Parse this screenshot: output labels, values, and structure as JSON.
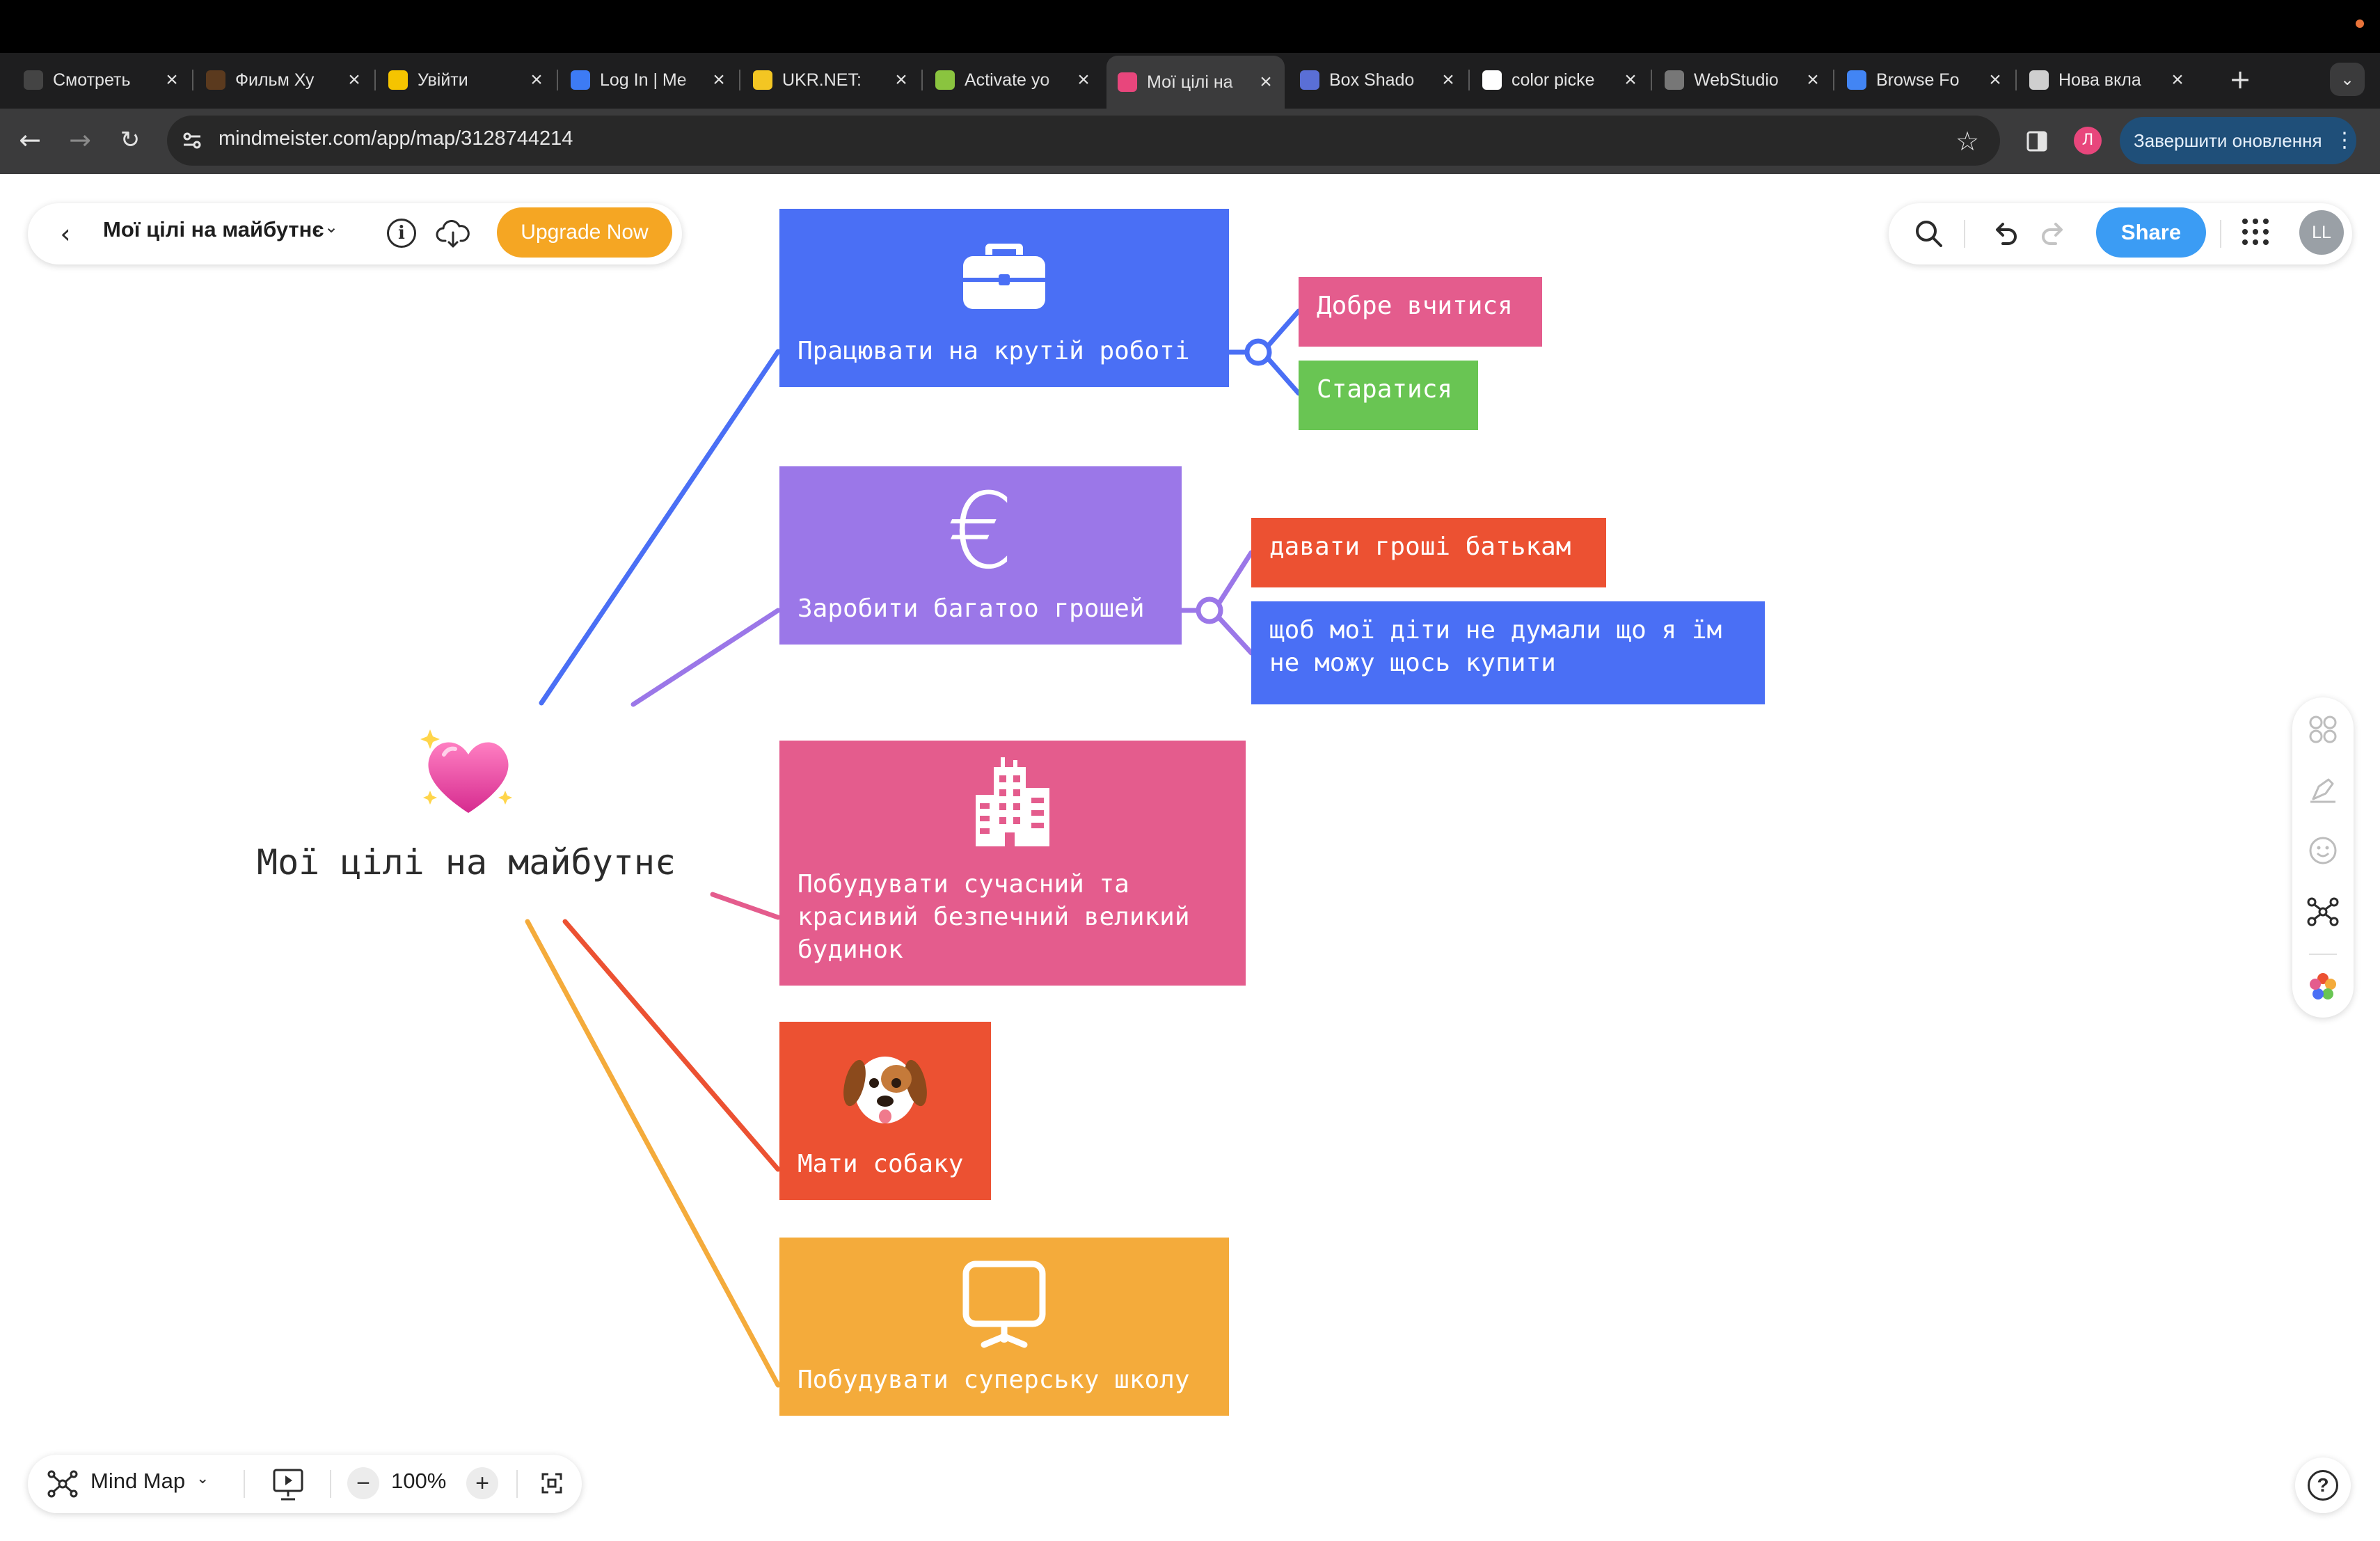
{
  "browser": {
    "tabs": [
      {
        "title": "Смотреть",
        "favicon": "hd-icon",
        "color": "#444444"
      },
      {
        "title": "Фильм Ху",
        "favicon": "mask-icon",
        "color": "#5b3a1e"
      },
      {
        "title": "Увійти",
        "favicon": "login-icon",
        "color": "#f5c400"
      },
      {
        "title": "Log In | Me",
        "favicon": "star-icon",
        "color": "#3d7bf4"
      },
      {
        "title": "UKR.NET:",
        "favicon": "ukrnet-icon",
        "color": "#f3c623"
      },
      {
        "title": "Activate yo",
        "favicon": "android-icon",
        "color": "#8ac43f"
      },
      {
        "title": "Мої цілі на",
        "favicon": "mindmeister-icon",
        "color": "#e8467c",
        "active": true
      },
      {
        "title": "Box Shado",
        "favicon": "box-icon",
        "color": "#5a6fd6"
      },
      {
        "title": "color picke",
        "favicon": "google-icon",
        "color": "#ffffff"
      },
      {
        "title": "WebStudio",
        "favicon": "globe-icon",
        "color": "#777777"
      },
      {
        "title": "Browse Fo",
        "favicon": "fonts-icon",
        "color": "#4285f4"
      },
      {
        "title": "Нова вкла",
        "favicon": "chrome-icon",
        "color": "#cfcfcf"
      }
    ],
    "url": "mindmeister.com/app/map/3128744214",
    "profile_initial": "Л",
    "update_label": "Завершити оновлення"
  },
  "toolbar": {
    "map_title": "Мої цілі на майбутнє",
    "upgrade_label": "Upgrade Now",
    "share_label": "Share",
    "avatar_initials": "LL"
  },
  "map": {
    "root": {
      "label": "Мої цілі на майбутнє",
      "icon": "sparkling-heart-emoji"
    },
    "branches": [
      {
        "label": "Працювати на крутій роботі",
        "icon": "briefcase-icon",
        "color": "#4a6ff5",
        "children": [
          {
            "label": "Добре вчитися",
            "color": "#e45c8d"
          },
          {
            "label": "Старатися",
            "color": "#69c553"
          }
        ]
      },
      {
        "label": "Заробити багатоо грошей",
        "icon": "euro-icon",
        "color": "#9b77e8",
        "children": [
          {
            "label": "давати гроші батькам",
            "color": "#ec5132"
          },
          {
            "label": "щоб мої діти не думали що я їм\nне можу щось купити",
            "color": "#4a6ff5"
          }
        ]
      },
      {
        "label": "Побудувати сучасний та\nкрасивий безпечний  великий\nбудинок",
        "icon": "buildings-icon",
        "color": "#e45c8d"
      },
      {
        "label": "Мати собаку",
        "icon": "dog-face-emoji",
        "color": "#ec5132"
      },
      {
        "label": "Побудувати суперську школу",
        "icon": "presentation-board-icon",
        "color": "#f4ab3b"
      }
    ]
  },
  "bottombar": {
    "view_label": "Mind Map",
    "zoom": "100%",
    "zoom_out": "−",
    "zoom_in": "+"
  },
  "sidetools": [
    "layout-icon",
    "style-brush-icon",
    "emoji-icon",
    "connections-icon",
    "color-palette-icon"
  ]
}
